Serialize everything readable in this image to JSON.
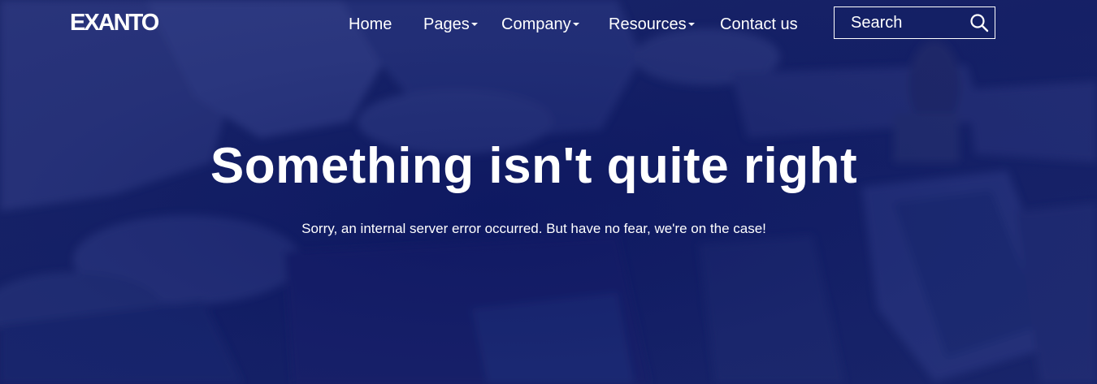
{
  "brand": {
    "logo_text": "EXANTO"
  },
  "nav": {
    "items": [
      {
        "label": "Home",
        "has_dropdown": false
      },
      {
        "label": "Pages",
        "has_dropdown": true
      },
      {
        "label": "Company",
        "has_dropdown": true
      },
      {
        "label": "Resources",
        "has_dropdown": true
      },
      {
        "label": "Contact us",
        "has_dropdown": false
      }
    ],
    "dropdown_icon": "caret-down-icon"
  },
  "search": {
    "placeholder": "Search",
    "value": "",
    "icon": "search-icon"
  },
  "hero": {
    "heading": "Something isn't quite right",
    "message": "Sorry, an internal server error occurred. But have no fear, we're on the case!",
    "background": "team-meeting-photo",
    "overlay_color": "#0d1a6e"
  },
  "colors": {
    "text": "#ffffff",
    "overlay": "#0d1a6e"
  }
}
